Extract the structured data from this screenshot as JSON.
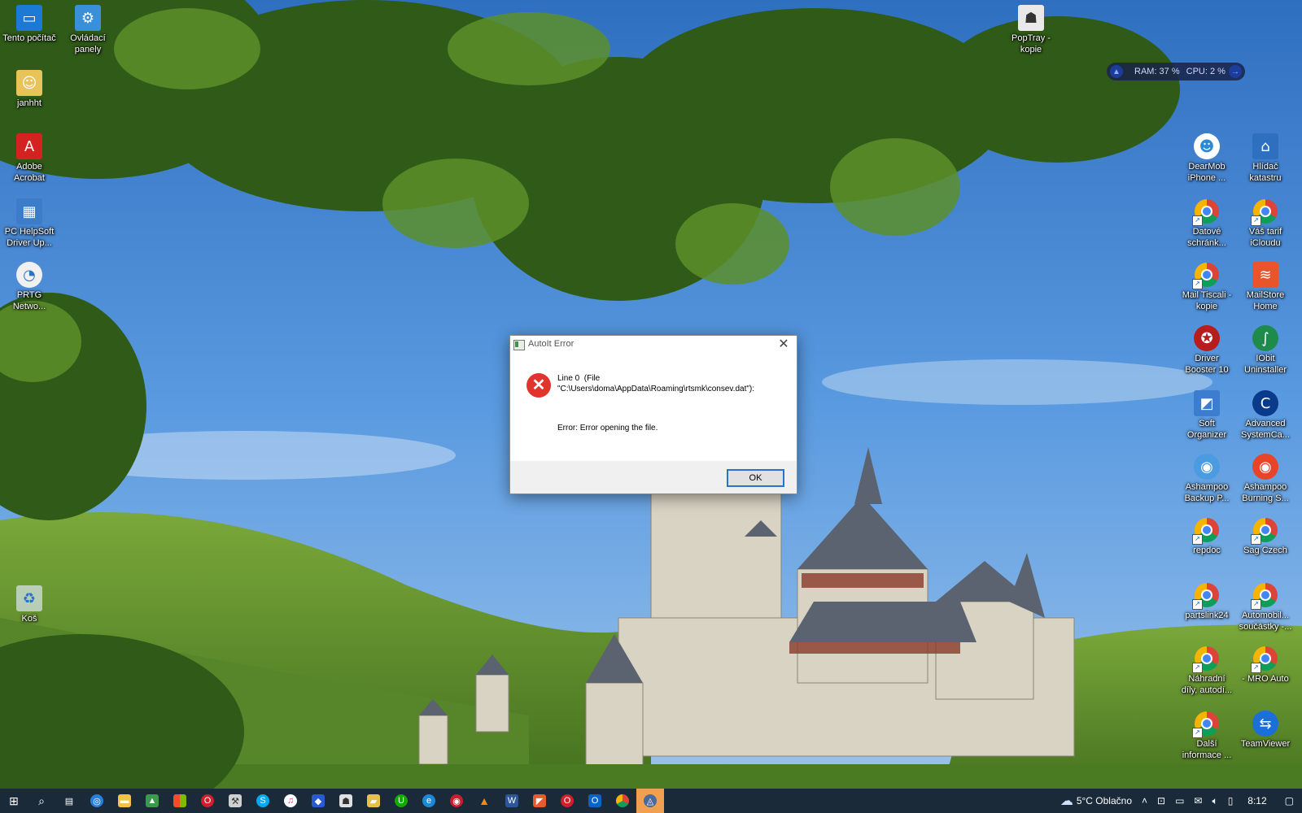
{
  "desktop": {
    "left_icons": [
      {
        "label": "Tento počítač",
        "icon": "computer-icon"
      },
      {
        "label": "Ovládací\npanely",
        "icon": "control-panel-icon"
      },
      {
        "label": "janhht",
        "icon": "user-folder-icon"
      },
      {
        "label": "Adobe\nAcrobat",
        "icon": "acrobat-icon"
      },
      {
        "label": "PC HelpSoft\nDriver Up...",
        "icon": "driver-updater-icon"
      },
      {
        "label": "PRTG\nNetwo...",
        "icon": "prtg-icon"
      },
      {
        "label": "Koš",
        "icon": "recycle-bin-icon"
      }
    ],
    "top_right_icon": {
      "label": "PopTray -\nkopie",
      "icon": "poptray-icon"
    },
    "right_icons": [
      {
        "label": "DearMob\niPhone ...",
        "icon": "dearmob-icon"
      },
      {
        "label": "Hlídač\nkatastru",
        "icon": "hlidac-icon"
      },
      {
        "label": "Datové\nschránk...",
        "icon": "chrome-icon"
      },
      {
        "label": "Váš tarif\niCloudu",
        "icon": "chrome-icon"
      },
      {
        "label": "Mail Tiscali -\nkopie",
        "icon": "chrome-icon"
      },
      {
        "label": "MailStore\nHome",
        "icon": "mailstore-icon"
      },
      {
        "label": "Driver\nBooster 10",
        "icon": "driver-booster-icon"
      },
      {
        "label": "IObit\nUninstaller",
        "icon": "iobit-icon"
      },
      {
        "label": "Soft\nOrganizer",
        "icon": "soft-organizer-icon"
      },
      {
        "label": "Advanced\nSystemCa...",
        "icon": "advanced-systemcare-icon"
      },
      {
        "label": "Ashampoo\nBackup P...",
        "icon": "ashampoo-backup-icon"
      },
      {
        "label": "Ashampoo\nBurning S...",
        "icon": "ashampoo-burning-icon"
      },
      {
        "label": "repdoc",
        "icon": "chrome-icon"
      },
      {
        "label": "Sag Czech",
        "icon": "chrome-icon"
      },
      {
        "label": "partslink24",
        "icon": "chrome-icon"
      },
      {
        "label": "Automobil...\nsoučástky -...",
        "icon": "chrome-icon"
      },
      {
        "label": "Náhradní\ndíly, autodí...",
        "icon": "chrome-icon"
      },
      {
        "label": "- MRO Auto",
        "icon": "chrome-icon"
      },
      {
        "label": "Další\ninformace ...",
        "icon": "chrome-icon"
      },
      {
        "label": "TeamViewer",
        "icon": "teamviewer-icon"
      }
    ]
  },
  "sysmon": {
    "ram": "RAM: 37 %",
    "cpu": "CPU: 2 %"
  },
  "dialog": {
    "title": "AutoIt Error",
    "message_line1": "Line 0  (File",
    "message_line2": "\"C:\\Users\\doma\\AppData\\Roaming\\rtsmk\\consev.dat\"):",
    "error_text": "Error: Error opening the file.",
    "ok_label": "OK"
  },
  "taskbar": {
    "apps": [
      "start-icon",
      "search-icon",
      "task-view-icon",
      "app-icon",
      "file-explorer-icon",
      "photos-icon",
      "store-icon",
      "opera-icon",
      "tool-icon",
      "skype-icon",
      "itunes-icon",
      "shield-app-icon",
      "app-icon",
      "file-folder-icon",
      "upwork-icon",
      "edge-icon",
      "media-icon",
      "vlc-icon",
      "word-icon",
      "app-icon",
      "opera-icon",
      "outlook-icon",
      "chrome-icon",
      "app-icon"
    ],
    "weather": "5°C  Oblačno",
    "time": "8:12"
  },
  "colors": {
    "taskbar": "#1b2a39",
    "dialog_button_border": "#2a73c9",
    "error_red": "#e0342c"
  }
}
